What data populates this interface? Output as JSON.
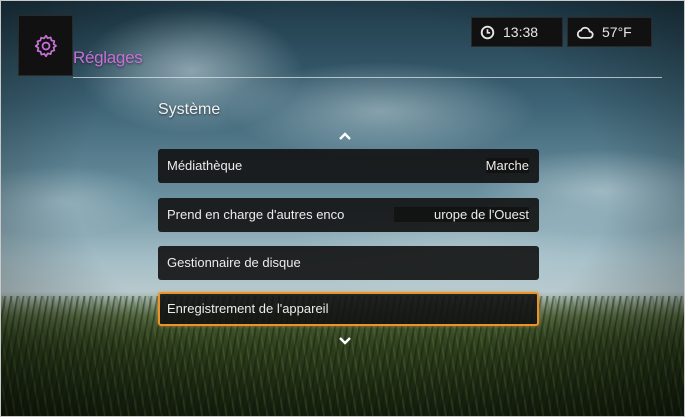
{
  "header": {
    "title": "Réglages",
    "app_icon": "gear-icon",
    "title_color": "#c770d8"
  },
  "status": {
    "time": "13:38",
    "time_icon": "clock-icon",
    "temperature": "57°F",
    "weather_icon": "cloud-icon"
  },
  "section": {
    "title": "Système",
    "scroll_up_icon": "chevron-up-icon",
    "scroll_down_icon": "chevron-down-icon"
  },
  "menu": {
    "items": [
      {
        "label": "Médiathèque",
        "value": "Marche"
      },
      {
        "label": "Prend en charge d'autres enco",
        "value": "urope de l'Ouest"
      },
      {
        "label": "Gestionnaire de disque",
        "value": ""
      },
      {
        "label": "Enregistrement de l'appareil",
        "value": "",
        "selected": true
      }
    ]
  },
  "colors": {
    "accent": "#c770d8",
    "selection": "#e8942a",
    "item_background": "#121212"
  }
}
